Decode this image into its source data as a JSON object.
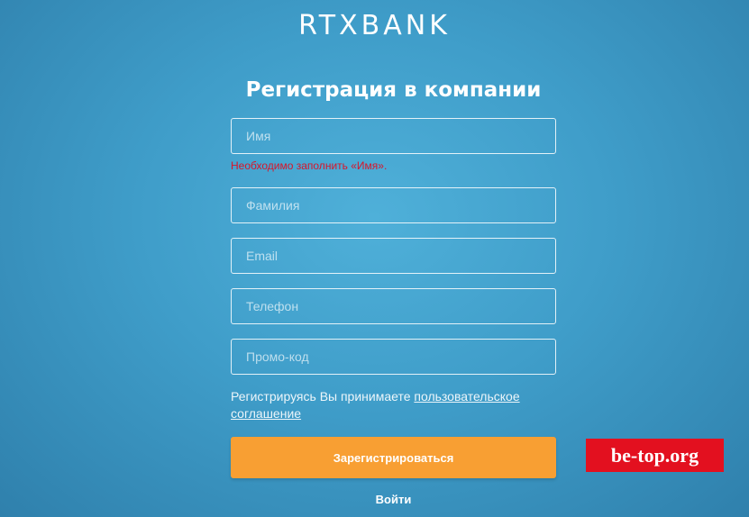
{
  "brand": {
    "logo_text": "RTXBANK"
  },
  "page": {
    "title": "Регистрация в компании"
  },
  "form": {
    "first_name": {
      "placeholder": "Имя",
      "value": ""
    },
    "first_name_error": "Необходимо заполнить «Имя».",
    "last_name": {
      "placeholder": "Фамилия",
      "value": ""
    },
    "email": {
      "placeholder": "Email",
      "value": ""
    },
    "phone": {
      "placeholder": "Телефон",
      "value": ""
    },
    "promo_code": {
      "placeholder": "Промо-код",
      "value": ""
    },
    "agreement_text": "Регистрируясь Вы принимаете ",
    "agreement_link": "пользовательское соглашение",
    "submit_label": "Зарегистрироваться",
    "login_label": "Войти"
  },
  "watermark": {
    "text": "be-top.org"
  },
  "colors": {
    "accent": "#f89f33",
    "error": "#d8152a",
    "watermark_bg": "#e3101f"
  }
}
